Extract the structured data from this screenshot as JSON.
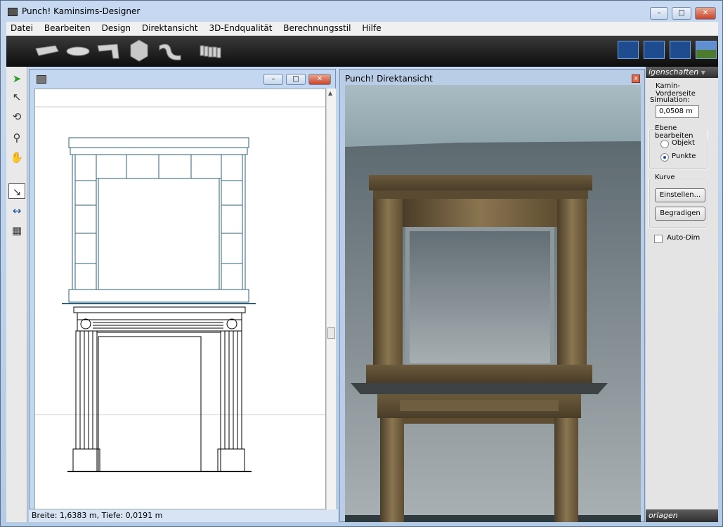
{
  "window": {
    "title": "Punch! Kaminsims-Designer",
    "minimize": "–",
    "maximize": "□",
    "close": "✕"
  },
  "menu": [
    "Datei",
    "Bearbeiten",
    "Design",
    "Direktansicht",
    "3D-Endqualität",
    "Berechnungsstil",
    "Hilfe"
  ],
  "toolbar": {
    "shapes": [
      "straight-molding-icon",
      "oval-molding-icon",
      "corner-molding-icon",
      "hexagon-block-icon",
      "curved-molding-icon",
      "dentil-molding-icon"
    ],
    "view_buttons": [
      "plan-view-icon",
      "split-view-icon",
      "quad-view-icon",
      "3d-view-icon"
    ]
  },
  "left_tools": [
    "select-arrow-icon",
    "point-select-icon",
    "rotate-icon",
    "zoom-icon",
    "pan-hand-icon",
    "edit-arrow-icon",
    "dimension-icon",
    "texture-icon"
  ],
  "drawing_window": {
    "minimize": "–",
    "maximize": "□",
    "close": "✕"
  },
  "status": {
    "text": "Breite: 1,6383 m, Tiefe: 0,0191 m"
  },
  "direktansicht": {
    "title": "Punch! Direktansicht",
    "close": "x"
  },
  "properties": {
    "header": "igenschaften",
    "object_name": "Kamin-Vorderseite",
    "simulation_label": "Simulation:",
    "simulation_value": "0,0508 m",
    "ebene_title": "Ebene bearbeiten",
    "radio_objekt": "Objekt",
    "radio_punkte": "Punkte",
    "kurve_title": "Kurve",
    "btn_einstellen": "Einstellen...",
    "btn_begradigen": "Begradigen",
    "auto_dim": "Auto-Dim",
    "footer": "orlagen"
  },
  "colors": {
    "wood_dark": "#4a3d28",
    "wood_mid": "#6b5a3c",
    "wood_light": "#8a7550",
    "outline_blue": "#2b5f7a"
  }
}
